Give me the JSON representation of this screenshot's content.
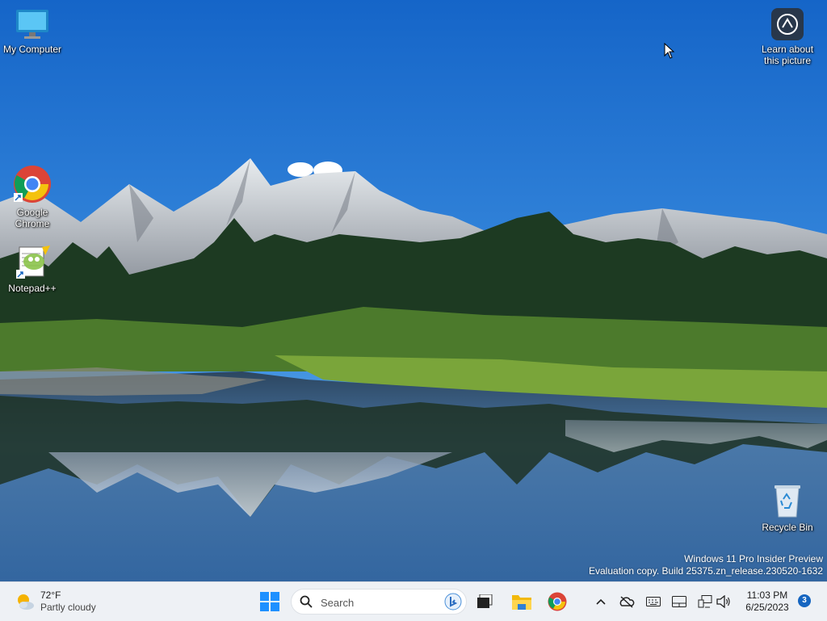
{
  "desktop": {
    "icons": {
      "my_computer": "My Computer",
      "chrome": "Google Chrome",
      "notepad": "Notepad++",
      "learn": "Learn about this picture",
      "recycle": "Recycle Bin"
    },
    "watermark": {
      "line1": "Windows 11 Pro Insider Preview",
      "line2": "Evaluation copy. Build 25375.zn_release.230520-1632"
    }
  },
  "taskbar": {
    "weather": {
      "temp": "72°F",
      "condition": "Partly cloudy",
      "icon": "partly-cloudy-icon"
    },
    "start": {
      "icon": "windows-logo-icon"
    },
    "search": {
      "placeholder": "Search",
      "icon": "search-icon",
      "badge_icon": "bing-icon"
    },
    "pinned": [
      "task-view-icon",
      "file-explorer-icon",
      "chrome-icon"
    ],
    "tray": [
      "chevron-up-icon",
      "onedrive-offline-icon",
      "keyboard-icon",
      "touchpad-icon",
      "network-icon",
      "volume-icon"
    ],
    "clock": {
      "time": "11:03 PM",
      "date": "6/25/2023"
    },
    "notification_count": "3"
  },
  "colors": {
    "sky": "#2f7fd4",
    "taskbar": "#eef1f5",
    "accent": "#1565c0"
  }
}
